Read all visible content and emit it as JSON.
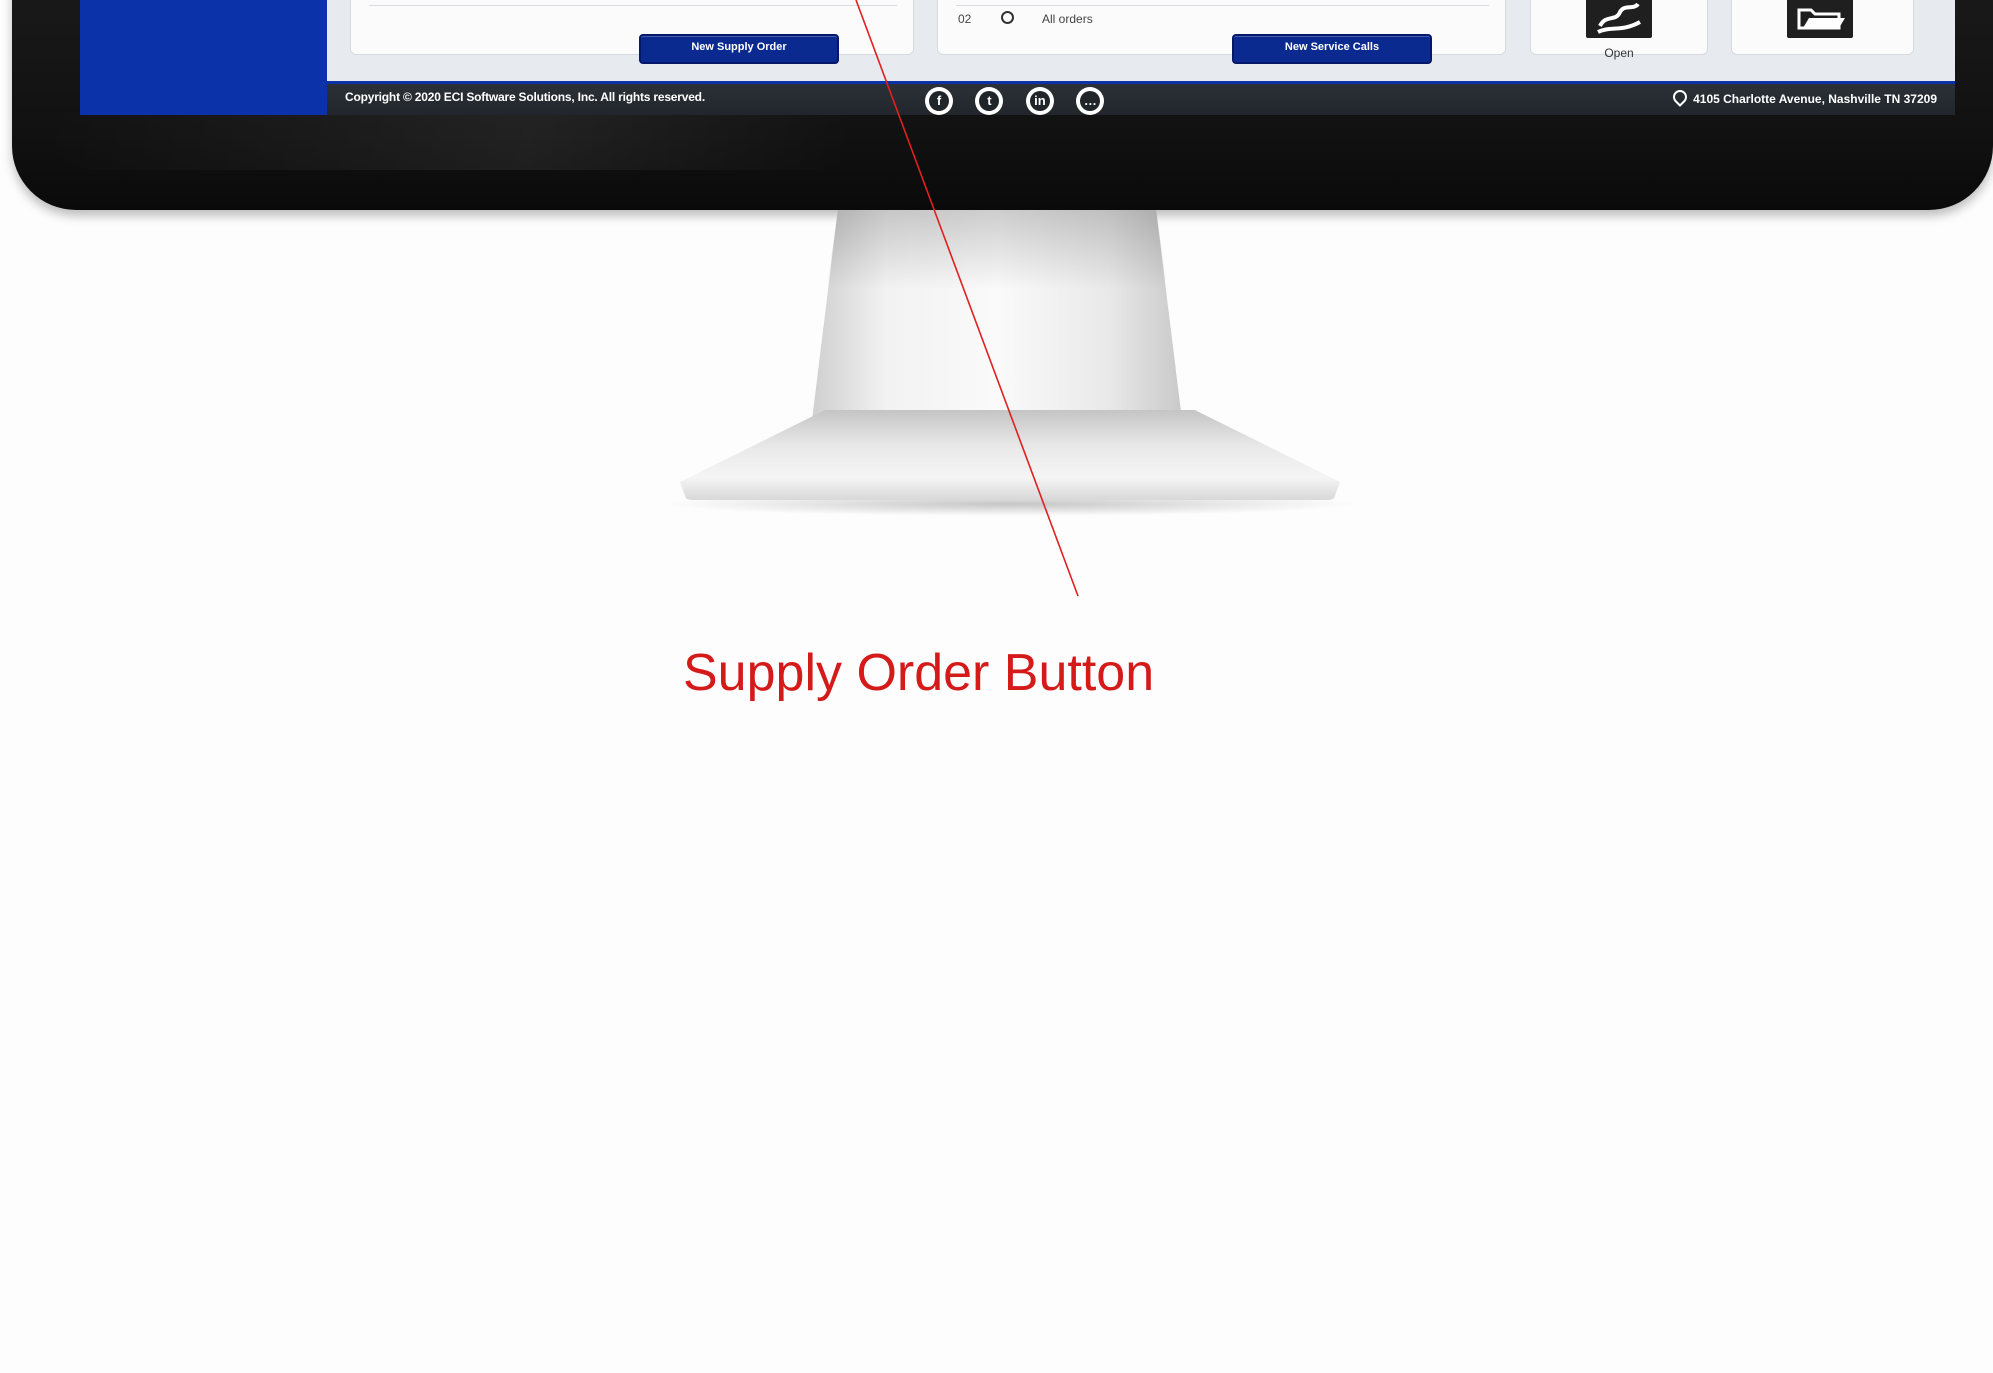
{
  "panels": {
    "supply": {
      "button_label": "New Supply Order"
    },
    "service": {
      "row_number": "02",
      "row_label": "All orders",
      "button_label": "New Service Calls"
    },
    "open_tile": {
      "label": "Open",
      "icon": "hands-icon"
    },
    "folder_tile": {
      "icon": "folder-open-icon"
    }
  },
  "footer": {
    "copyright": "Copyright © 2020 ECI Software Solutions, Inc. All rights reserved.",
    "social_icons": [
      "facebook-icon",
      "twitter-icon",
      "linkedin-icon",
      "chat-icon"
    ],
    "address": "4105 Charlotte Avenue, Nashville TN 37209"
  },
  "annotation": {
    "text": "Supply Order Button",
    "color": "#d51a1a"
  },
  "colors": {
    "brand_blue": "#0b32a8",
    "button_blue": "#0a2a8f",
    "footer_dark": "#20252a"
  }
}
